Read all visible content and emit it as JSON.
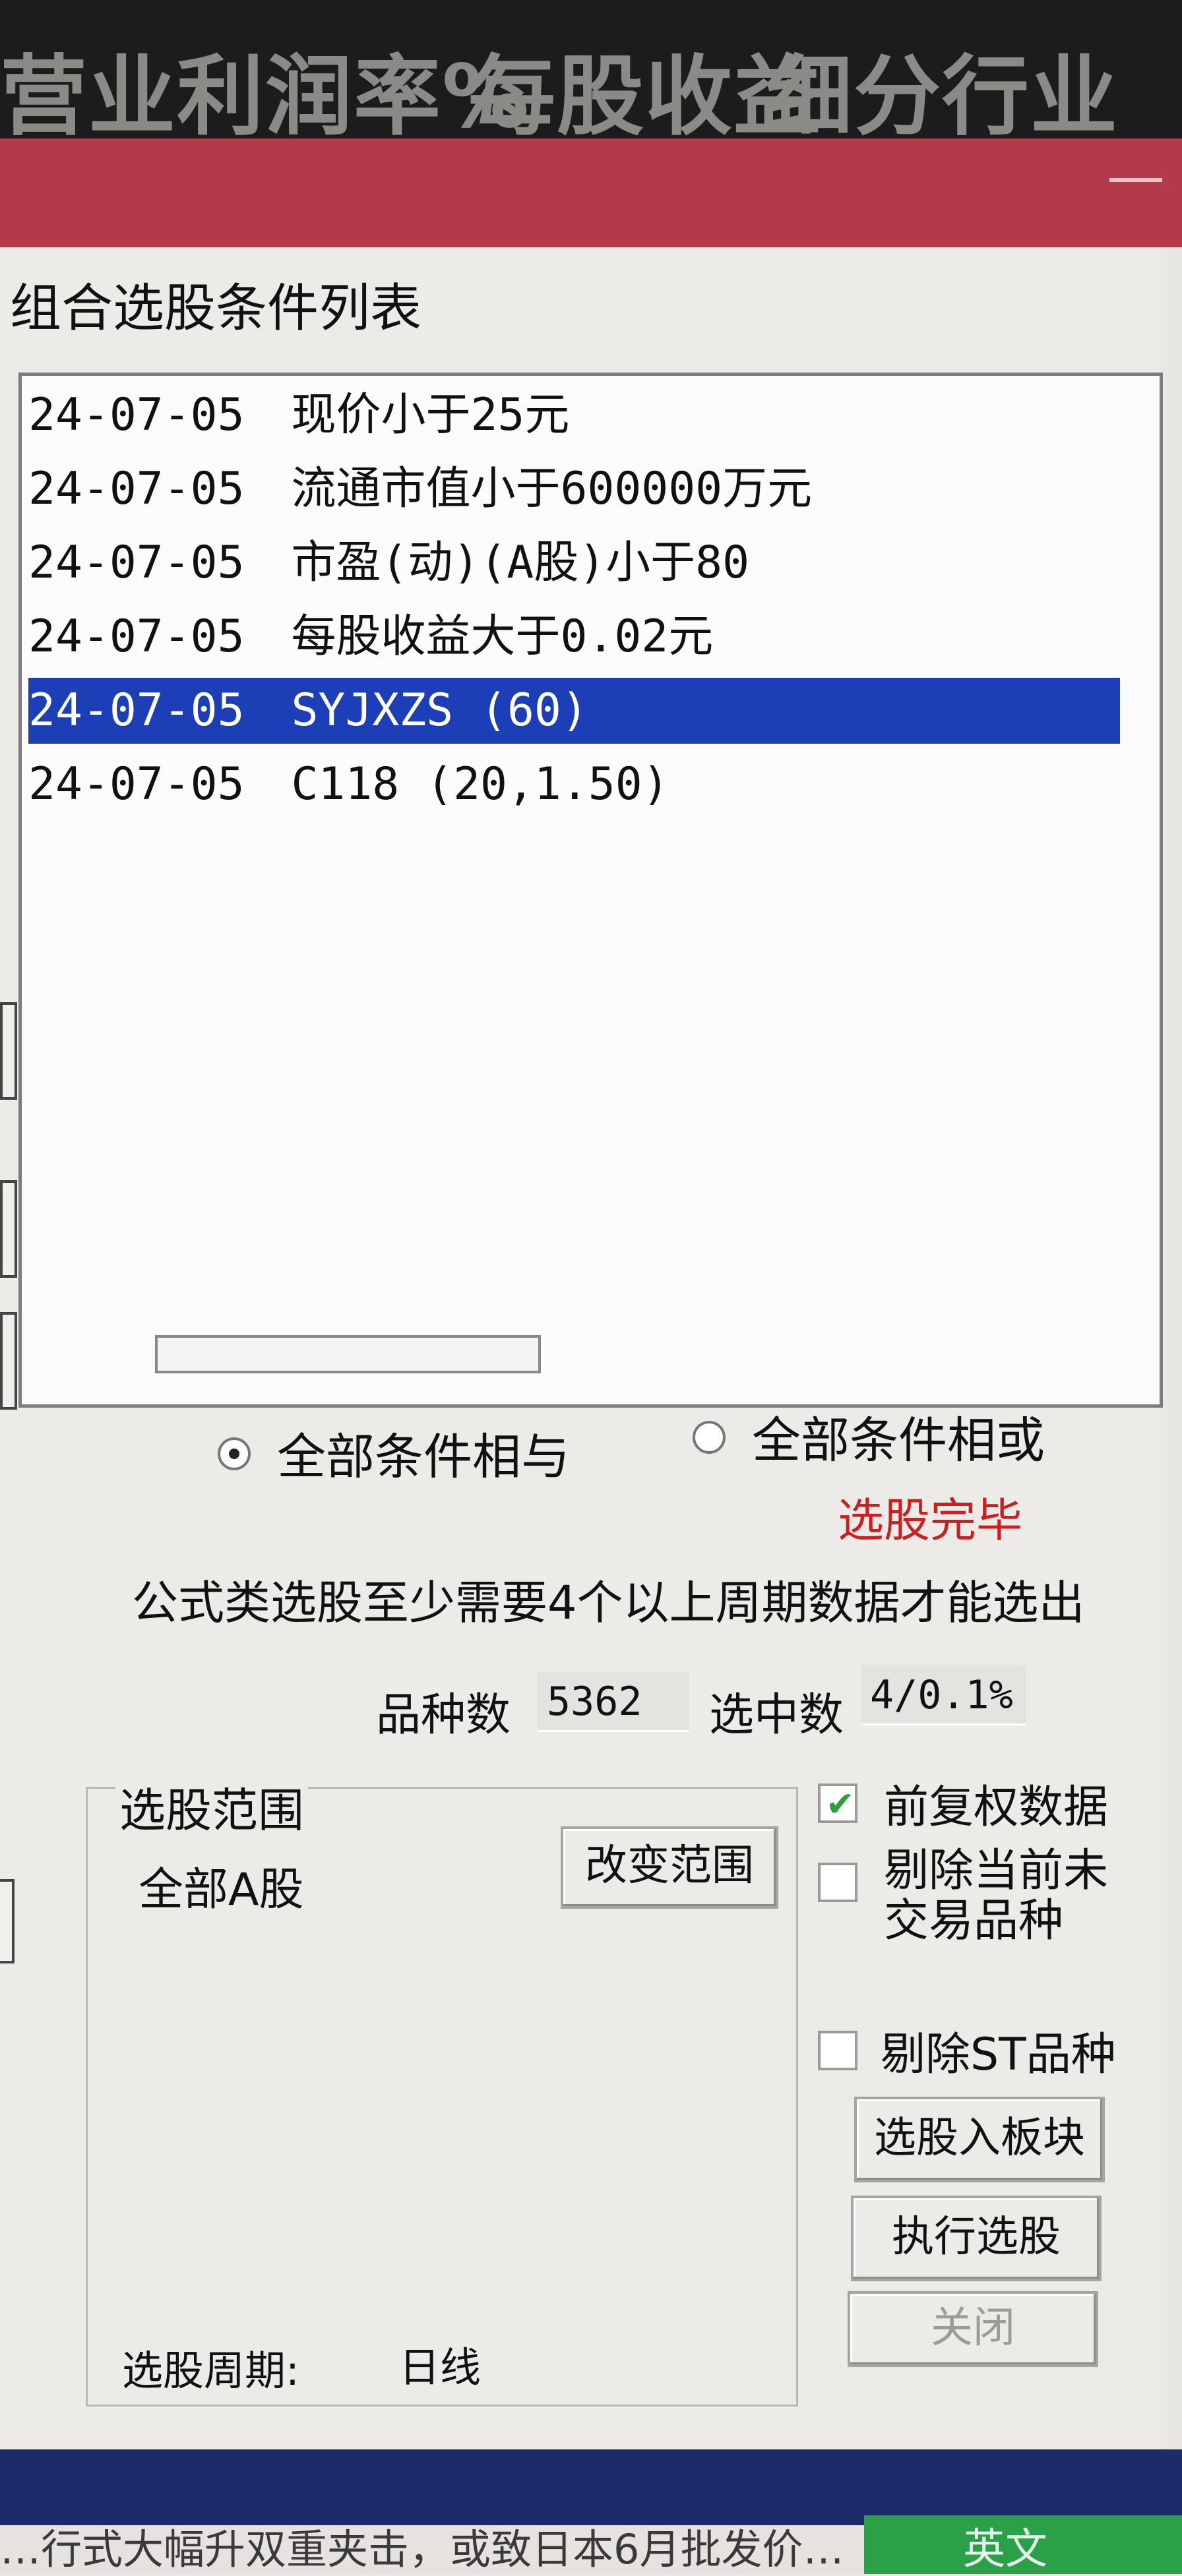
{
  "background_header": {
    "columns": [
      "营业利润率%",
      "每股收益",
      "细分行业"
    ]
  },
  "dialog": {
    "list_title": "组合选股条件列表",
    "conditions": [
      {
        "date": "24-07-05",
        "text": "现价小于25元"
      },
      {
        "date": "24-07-05",
        "text": "流通市值小于600000万元"
      },
      {
        "date": "24-07-05",
        "text": "市盈(动)(A股)小于80"
      },
      {
        "date": "24-07-05",
        "text": "每股收益大于0.02元"
      },
      {
        "date": "24-07-05",
        "text": "SYJXZS (60)",
        "selected": true
      },
      {
        "date": "24-07-05",
        "text": "C118 (20,1.50)"
      }
    ],
    "radio_and": {
      "label": "全部条件相与",
      "checked": true
    },
    "radio_or": {
      "label": "全部条件相或",
      "checked": false
    },
    "status": "选股完毕",
    "info": "公式类选股至少需要4个以上周期数据才能选出",
    "count_label": "品种数",
    "count_value": "5362",
    "selected_label": "选中数",
    "selected_value": "4/0.1%",
    "range_title": "选股范围",
    "range_value": "全部A股",
    "change_range_button": "改变范围",
    "checkbox_fuquan": {
      "label": "前复权数据",
      "checked": true
    },
    "checkbox_exclude_untraded": {
      "label": "剔除当前未交易品种",
      "checked": false
    },
    "checkbox_exclude_st": {
      "label": "剔除ST品种",
      "checked": false
    },
    "btn_add_block": "选股入板块",
    "btn_execute": "执行选股",
    "btn_close": "关闭",
    "period_label": "选股周期:",
    "period_value": "日线"
  },
  "taskbar": {
    "marquee": "…行式大幅升双重夹击，或致日本6月批发价…",
    "ime": "英文"
  },
  "colors": {
    "title_bar": "#b33a4a",
    "selection": "#1c3fb8",
    "status_red": "#cc1f1f",
    "taskbar": "#1e2b6b"
  }
}
